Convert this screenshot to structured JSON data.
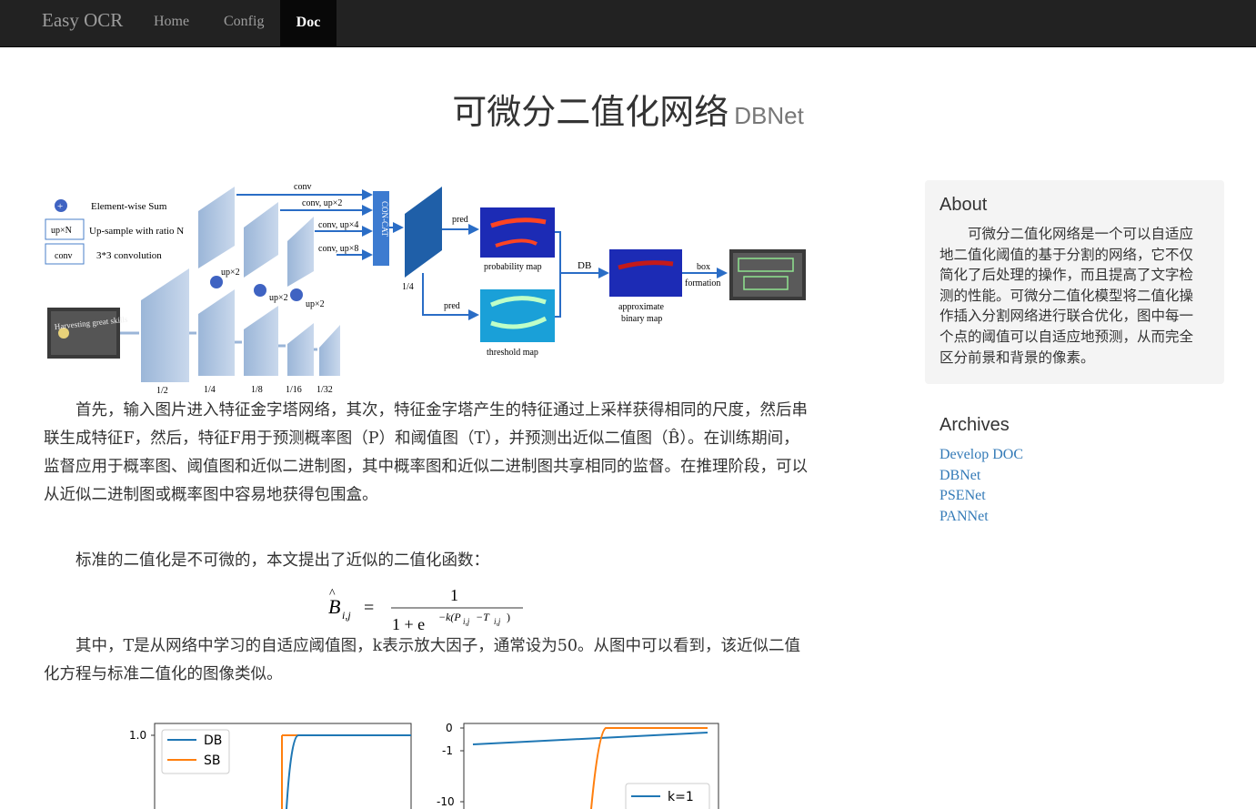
{
  "nav": {
    "brand": "Easy OCR",
    "items": [
      {
        "label": "Home"
      },
      {
        "label": "Config"
      },
      {
        "label": "Doc"
      }
    ]
  },
  "header": {
    "title": "可微分二值化网络",
    "subtitle": "DBNet"
  },
  "figure": {
    "legend": {
      "sum": "Element-wise Sum",
      "upn_box": "up×N",
      "upn": "Up-sample with ratio N",
      "conv_box": "conv",
      "conv": "3*3 convolution"
    },
    "concat": "CON-CAT",
    "conv_labels": [
      "conv",
      "conv, up×2",
      "conv, up×4",
      "conv, up×8"
    ],
    "up_labels": [
      "up×2",
      "up×2",
      "up×2"
    ],
    "scales": [
      "1/2",
      "1/4",
      "1/8",
      "1/16",
      "1/32"
    ],
    "quarter": "1/4",
    "pred": "pred",
    "pred2": "pred",
    "prob_map": "probability map",
    "threshold_map": "threshold map",
    "db": "DB",
    "approx_1": "approximate",
    "approx_2": "binary map",
    "box_1": "box",
    "box_2": "formation",
    "sample_text": "Harvesting great skills"
  },
  "article": {
    "p1": "首先，输入图片进入特征金字塔网络，其次，特征金字塔产生的特征通过上采样获得相同的尺度，然后串联生成特征F，然后，特征F用于预测概率图（P）和阈值图（T），并预测出近似二值图（B̂）。在训练期间，监督应用于概率图、阈值图和近似二进制图，其中概率图和近似二进制图共享相同的监督。在推理阶段，可以从近似二进制图或概率图中容易地获得包围盒。",
    "p2": "标准的二值化是不可微的，本文提出了近似的二值化函数：",
    "p3": "其中，T是从网络中学习的自适应阈值图，k表示放大因子，通常设为50。从图中可以看到，该近似二值化方程与标准二值化的图像类似。",
    "equation": {
      "lhs_B": "B",
      "lhs_sub": "i,j",
      "eq": "=",
      "num": "1",
      "den_a": "1 + e",
      "den_exp": "−k(P",
      "den_exp_sub1": "i,j",
      "den_exp_mid": "−T",
      "den_exp_sub2": "i,j",
      "den_exp_end": ")"
    }
  },
  "plots": {
    "left": {
      "ytick": "1.0",
      "legend": [
        "DB",
        "SB"
      ]
    },
    "right": {
      "yticks": [
        "0",
        "-1",
        "-10"
      ],
      "legend": [
        "k=1"
      ]
    },
    "colors": {
      "db": "#1f77b4",
      "sb": "#ff7f0e"
    }
  },
  "sidebar": {
    "about_title": "About",
    "about_text": "可微分二值化网络是一个可以自适应地二值化阈值的基于分割的网络，它不仅简化了后处理的操作，而且提高了文字检测的性能。可微分二值化模型将二值化操作插入分割网络进行联合优化，图中每一个点的阈值可以自适应地预测，从而完全区分前景和背景的像素。",
    "archives_title": "Archives",
    "archives": [
      "Develop DOC",
      "DBNet",
      "PSENet",
      "PANNet"
    ]
  }
}
